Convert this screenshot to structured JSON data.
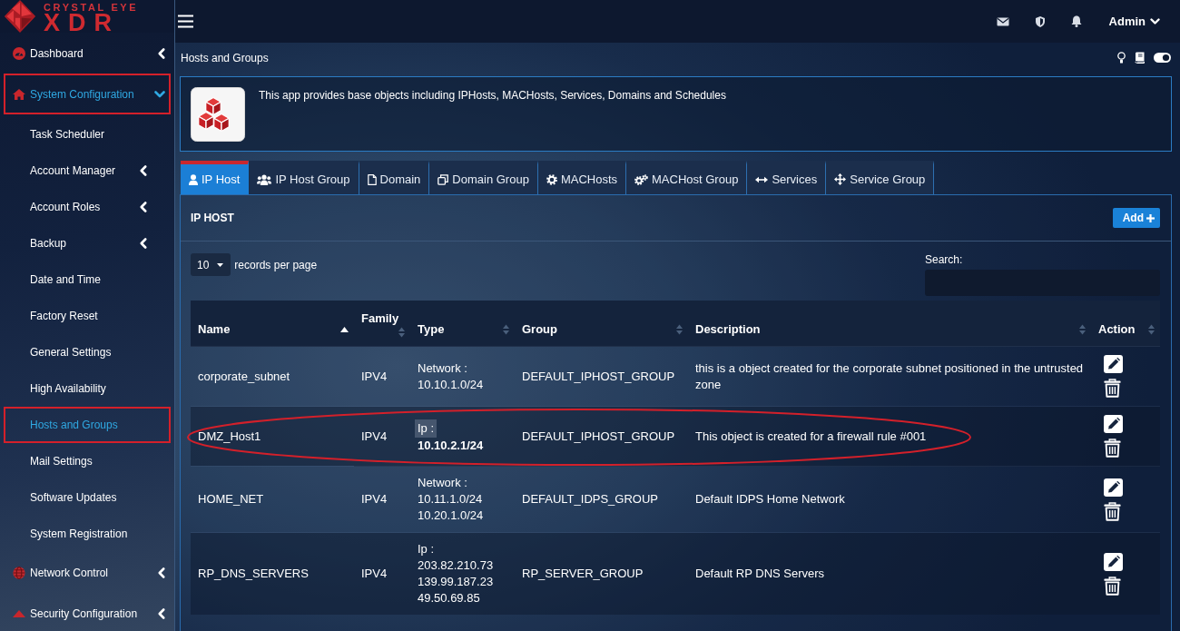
{
  "logo": {
    "tagline": "CRYSTAL EYE",
    "wordmark": "XDR"
  },
  "topbar": {
    "user": "Admin"
  },
  "sidebar": {
    "items": [
      {
        "label": "Dashboard",
        "expanded": false,
        "selected": false,
        "outlined": false
      },
      {
        "label": "System Configuration",
        "expanded": true,
        "selected": true,
        "outlined": true,
        "children": [
          {
            "label": "Task Scheduler",
            "kind": "link",
            "selected": false,
            "outlined": false
          },
          {
            "label": "Account Manager",
            "kind": "group",
            "expanded": false,
            "selected": false,
            "outlined": false
          },
          {
            "label": "Account Roles",
            "kind": "group",
            "expanded": false,
            "selected": false,
            "outlined": false
          },
          {
            "label": "Backup",
            "kind": "group",
            "expanded": false,
            "selected": false,
            "outlined": false
          },
          {
            "label": "Date and Time",
            "kind": "link",
            "selected": false,
            "outlined": false
          },
          {
            "label": "Factory Reset",
            "kind": "link",
            "selected": false,
            "outlined": false
          },
          {
            "label": "General Settings",
            "kind": "link",
            "selected": false,
            "outlined": false
          },
          {
            "label": "High Availability",
            "kind": "link",
            "selected": false,
            "outlined": false
          },
          {
            "label": "Hosts and Groups",
            "kind": "link",
            "selected": true,
            "outlined": true
          },
          {
            "label": "Mail Settings",
            "kind": "link",
            "selected": false,
            "outlined": false
          },
          {
            "label": "Software Updates",
            "kind": "link",
            "selected": false,
            "outlined": false
          },
          {
            "label": "System Registration",
            "kind": "link",
            "selected": false,
            "outlined": false
          }
        ]
      },
      {
        "label": "Network Control",
        "expanded": false,
        "selected": false,
        "outlined": false
      },
      {
        "label": "Security Configuration",
        "expanded": false,
        "selected": false,
        "outlined": false
      }
    ]
  },
  "page": {
    "title": "Hosts and Groups",
    "theme_toggle": {
      "on": true
    }
  },
  "app_info": {
    "description": "This app provides base objects including IPHosts, MACHosts, Services, Domains and Schedules"
  },
  "tabs": [
    {
      "label": "IP Host",
      "selected": true
    },
    {
      "label": "IP Host Group",
      "selected": false
    },
    {
      "label": "Domain",
      "selected": false
    },
    {
      "label": "Domain Group",
      "selected": false
    },
    {
      "label": "MACHosts",
      "selected": false
    },
    {
      "label": "MACHost Group",
      "selected": false
    },
    {
      "label": "Services",
      "selected": false
    },
    {
      "label": "Service Group",
      "selected": false
    }
  ],
  "panel": {
    "title": "IP HOST",
    "add_button": "Add",
    "page_size": "10",
    "page_size_label": "records per page",
    "search_label": "Search:"
  },
  "table": {
    "columns": [
      {
        "label": "Name",
        "sorted": true
      },
      {
        "label": "Family",
        "sorted": false
      },
      {
        "label": "Type",
        "sorted": false
      },
      {
        "label": "Group",
        "sorted": false
      },
      {
        "label": "Description",
        "sorted": false
      },
      {
        "label": "Action",
        "sorted": false
      }
    ],
    "rows": [
      {
        "name": "corporate_subnet",
        "family": "IPV4",
        "type": {
          "label": "Network :",
          "highlighted": false,
          "values": [
            "10.10.1.0/24"
          ],
          "bold": false
        },
        "group": "DEFAULT_IPHOST_GROUP",
        "description": "this is a object created for the corporate subnet positioned in the untrusted zone",
        "circled": false
      },
      {
        "name": "DMZ_Host1",
        "family": "IPV4",
        "type": {
          "label": "Ip :",
          "highlighted": true,
          "values": [
            "10.10.2.1/24"
          ],
          "bold": true
        },
        "group": "DEFAULT_IPHOST_GROUP",
        "description": "This object is created for a firewall rule #001",
        "circled": true
      },
      {
        "name": "HOME_NET",
        "family": "IPV4",
        "type": {
          "label": "Network :",
          "highlighted": false,
          "values": [
            "10.11.1.0/24",
            "10.20.1.0/24"
          ],
          "bold": false
        },
        "group": "DEFAULT_IDPS_GROUP",
        "description": "Default IDPS Home Network",
        "circled": false
      },
      {
        "name": "RP_DNS_SERVERS",
        "family": "IPV4",
        "type": {
          "label": "Ip :",
          "highlighted": false,
          "values": [
            "203.82.210.73",
            "139.99.187.23",
            "49.50.69.85"
          ],
          "bold": false
        },
        "group": "RP_SERVER_GROUP",
        "description": "Default RP DNS Servers",
        "circled": false
      }
    ]
  }
}
